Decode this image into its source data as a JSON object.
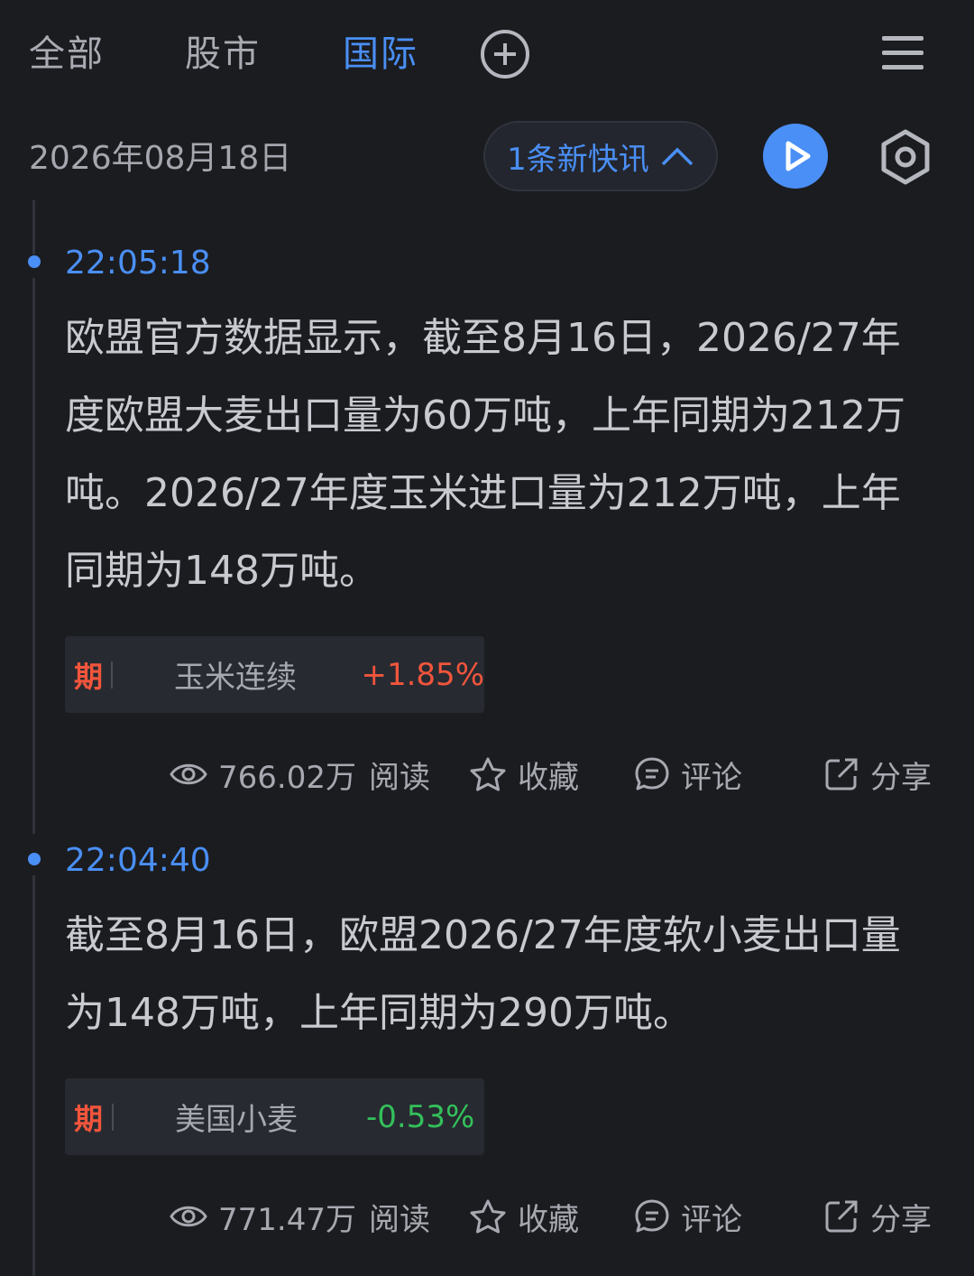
{
  "tabs": [
    {
      "label": "全部"
    },
    {
      "label": "股市"
    },
    {
      "label": "国际"
    }
  ],
  "active_tab": "国际",
  "date": "2026年08月18日",
  "new_flash_label": "1条新快讯",
  "items": [
    {
      "time": "22:05:18",
      "text": "欧盟官方数据显示，截至8月16日，2026/27年度欧盟大麦出口量为60万吨，上年同期为212万吨。2026/27年度玉米进口量为212万吨，上年同期为148万吨。",
      "tag": {
        "label": "期",
        "name": "玉米连续",
        "change": "+1.85%"
      },
      "views": "766.02万",
      "read_label": "阅读",
      "fav_label": "收藏",
      "comment_label": "评论",
      "share_label": "分享"
    },
    {
      "time": "22:04:40",
      "text": "截至8月16日，欧盟2026/27年度软小麦出口量为148万吨，上年同期为290万吨。",
      "tag": {
        "label": "期",
        "name": "美国小麦",
        "change": "-0.53%"
      },
      "views": "771.47万",
      "read_label": "阅读",
      "fav_label": "收藏",
      "comment_label": "评论",
      "share_label": "分享"
    }
  ],
  "colors": {
    "accent": "#4a8ff5",
    "up": "#f2553c",
    "down": "#33c05a",
    "background": "#1b1c20"
  }
}
